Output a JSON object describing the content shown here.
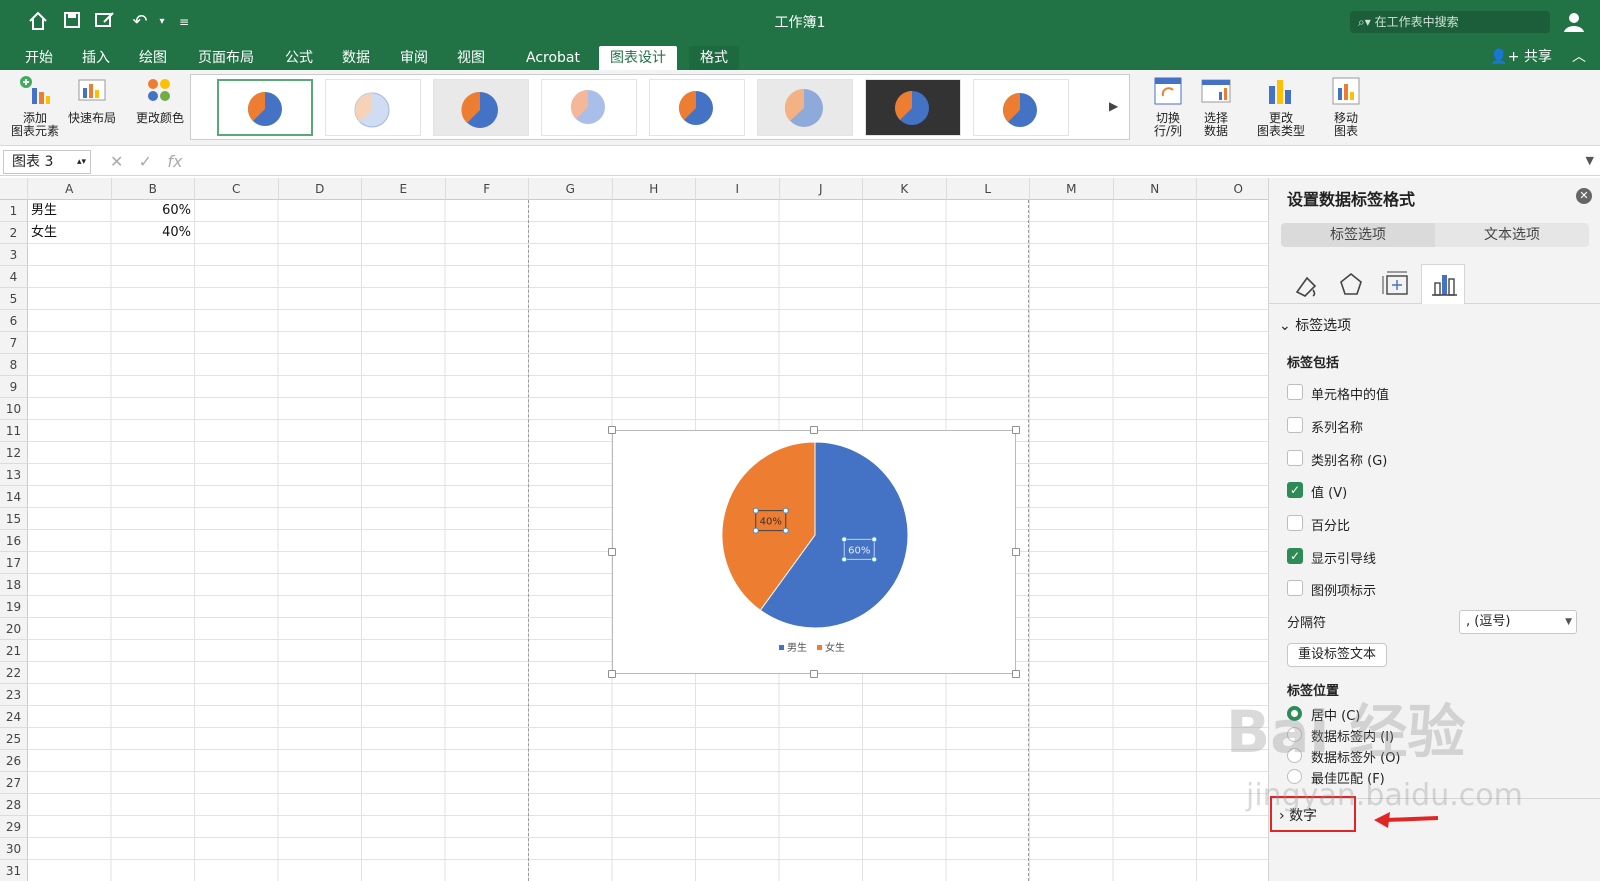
{
  "window": {
    "title": "工作簿1",
    "search_placeholder": "在工作表中搜索"
  },
  "ribbon_tabs": [
    {
      "label": "开始"
    },
    {
      "label": "插入"
    },
    {
      "label": "绘图"
    },
    {
      "label": "页面布局"
    },
    {
      "label": "公式"
    },
    {
      "label": "数据"
    },
    {
      "label": "审阅"
    },
    {
      "label": "视图"
    },
    {
      "label": "Acrobat"
    },
    {
      "label": "图表设计",
      "active": true
    },
    {
      "label": "格式"
    }
  ],
  "share_label": "共享",
  "ribbon_buttons": {
    "add_element": "添加\n图表元素",
    "quick_layout": "快速布局",
    "change_colors": "更改颜色",
    "switch_row_col": "切换\n行/列",
    "select_data": "选择\n数据",
    "change_type": "更改\n图表类型",
    "move_chart": "移动\n图表"
  },
  "formula_bar": {
    "name_box": "图表 3",
    "fx": "fx"
  },
  "columns": [
    "A",
    "B",
    "C",
    "D",
    "E",
    "F",
    "G",
    "H",
    "I",
    "J",
    "K",
    "L",
    "M",
    "N",
    "O"
  ],
  "rows": [
    "1",
    "2",
    "3",
    "4",
    "5",
    "6",
    "7",
    "8",
    "9",
    "10",
    "11",
    "12",
    "13",
    "14",
    "15",
    "16",
    "17",
    "18",
    "19",
    "20",
    "21",
    "22",
    "23",
    "24",
    "25",
    "26",
    "27",
    "28",
    "29",
    "30",
    "31"
  ],
  "cells": {
    "A1": "男生",
    "B1": "60%",
    "A2": "女生",
    "B2": "40%"
  },
  "chart_data": {
    "type": "pie",
    "categories": [
      "男生",
      "女生"
    ],
    "values": [
      60,
      40
    ],
    "data_labels": [
      "60%",
      "40%"
    ],
    "colors": [
      "#4472C4",
      "#ED7D31"
    ],
    "legend": "bottom"
  },
  "pane": {
    "title": "设置数据标签格式",
    "tabs": [
      "标签选项",
      "文本选项"
    ],
    "section": "标签选项",
    "label_contains": "标签包括",
    "checkboxes": [
      {
        "label": "单元格中的值",
        "checked": false
      },
      {
        "label": "系列名称",
        "checked": false
      },
      {
        "label": "类别名称 (G)",
        "checked": false
      },
      {
        "label": "值 (V)",
        "checked": true
      },
      {
        "label": "百分比",
        "checked": false
      },
      {
        "label": "显示引导线",
        "checked": true
      },
      {
        "label": "图例项标示",
        "checked": false
      }
    ],
    "separator_label": "分隔符",
    "separator_value": ", (逗号)",
    "reset_button": "重设标签文本",
    "position_label": "标签位置",
    "positions": [
      {
        "label": "居中 (C)",
        "selected": true
      },
      {
        "label": "数据标签内 (I)",
        "selected": false
      },
      {
        "label": "数据标签外 (O)",
        "selected": false
      },
      {
        "label": "最佳匹配 (F)",
        "selected": false
      }
    ],
    "number_section": "数字"
  },
  "watermark": {
    "brand": "Bai 经验",
    "url": "jingyan.baidu.com"
  },
  "colors": {
    "excel_green": "#217346",
    "accent_check": "#2e8b57",
    "highlight": "#e02525"
  }
}
